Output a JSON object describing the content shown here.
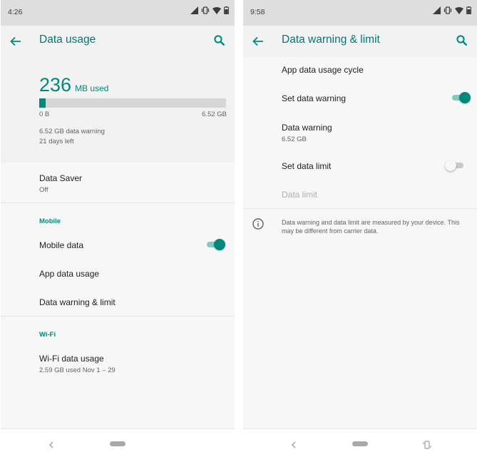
{
  "left": {
    "status": {
      "time": "4:26"
    },
    "appbar": {
      "title": "Data usage"
    },
    "summary": {
      "used_value": "236",
      "used_unit": "MB used",
      "bar_min": "0 B",
      "bar_max": "6.52 GB",
      "usage_fraction": 0.036,
      "warning_text": "6.52 GB data warning",
      "days_left": "21 days left"
    },
    "data_saver": {
      "label": "Data Saver",
      "value": "Off"
    },
    "mobile_section": "Mobile",
    "mobile_data": {
      "label": "Mobile data",
      "enabled": true
    },
    "app_data_usage": "App data usage",
    "data_warning_limit": "Data warning & limit",
    "wifi_section": "Wi-Fi",
    "wifi_data_usage": {
      "label": "Wi-Fi data usage",
      "value": "2.59 GB used Nov 1 – 29"
    }
  },
  "right": {
    "status": {
      "time": "9:58"
    },
    "appbar": {
      "title": "Data warning & limit"
    },
    "app_data_usage_cycle": "App data usage cycle",
    "set_data_warning": {
      "label": "Set data warning",
      "enabled": true
    },
    "data_warning": {
      "label": "Data warning",
      "value": "6.52 GB"
    },
    "set_data_limit": {
      "label": "Set data limit",
      "enabled": false
    },
    "data_limit": "Data limit",
    "info_text": "Data warning and data limit are measured by your device. This may be different from carrier data."
  },
  "colors": {
    "accent": "#00897b",
    "title": "#00786f",
    "statusbar": "#dedede",
    "background": "#f2f2f2"
  },
  "icons": [
    "signal-icon",
    "vibrate-icon",
    "wifi-icon",
    "battery-icon",
    "back-arrow-icon",
    "search-icon",
    "info-icon",
    "nav-back-icon",
    "nav-home-pill",
    "rotate-icon"
  ]
}
